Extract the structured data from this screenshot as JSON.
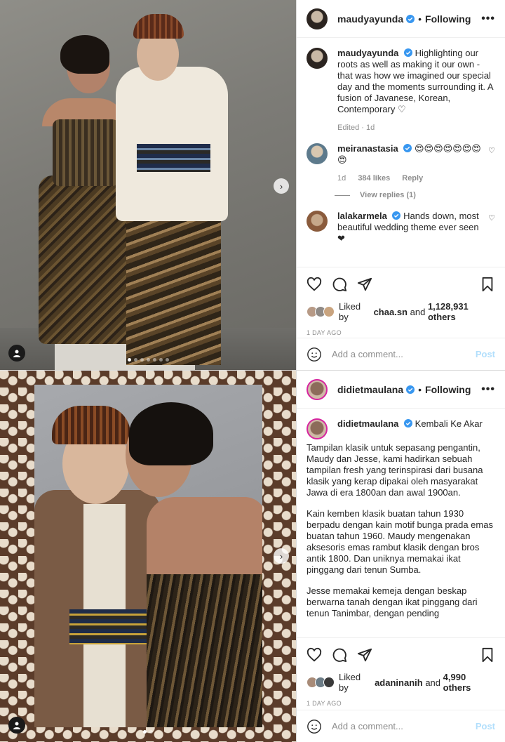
{
  "post1": {
    "header": {
      "username": "maudyayunda",
      "dot": "•",
      "follow_label": "Following",
      "more": "•••"
    },
    "caption": {
      "username": "maudyayunda",
      "text": "Highlighting our roots as well as making it our own - that was how we imagined our special day and the moments surrounding it. A fusion of Javanese, Korean, Contemporary ♡",
      "edited": "Edited · 1d"
    },
    "comments": [
      {
        "username": "meiranastasia",
        "text": "😍😍😍😍😍😍😍😍",
        "age": "1d",
        "likes": "384 likes",
        "reply": "Reply",
        "view_replies": "View replies (1)"
      },
      {
        "username": "lalakarmela",
        "text": "Hands down, most beautiful wedding theme ever seen ❤"
      }
    ],
    "liked_by_prefix": "Liked by",
    "liked_by_user": "chaa.sn",
    "liked_by_and": "and",
    "liked_by_count": "1,128,931 others",
    "time": "1 DAY AGO",
    "add_comment_placeholder": "Add a comment...",
    "post_label": "Post",
    "carousel": {
      "count": 7,
      "active": 0
    }
  },
  "post2": {
    "header": {
      "username": "didietmaulana",
      "dot": "•",
      "follow_label": "Following",
      "more": "•••"
    },
    "caption": {
      "username": "didietmaulana",
      "title": "Kembali Ke Akar",
      "p1": "Tampilan klasik untuk sepasang pengantin, Maudy dan Jesse, kami hadirkan sebuah tampilan fresh yang terinspirasi dari busana klasik yang kerap dipakai oleh masyarakat Jawa di era 1800an dan awal 1900an.",
      "p2": "Kain kemben klasik buatan tahun 1930 berpadu dengan kain motif bunga prada emas buatan tahun 1960. Maudy mengenakan aksesoris emas rambut klasik dengan bros antik 1800. Dan uniknya memakai ikat pinggang dari tenun Sumba.",
      "p3": "Jesse memakai kemeja dengan beskap berwarna tanah dengan ikat pinggang dari tenun Tanimbar, dengan pending"
    },
    "liked_by_prefix": "Liked by",
    "liked_by_user": "adaninanih",
    "liked_by_and": "and",
    "liked_by_count": "4,990 others",
    "time": "1 DAY AGO",
    "add_comment_placeholder": "Add a comment...",
    "post_label": "Post",
    "carousel": {
      "count": 2,
      "active": 0
    }
  },
  "colors": {
    "verified": "#3897f0",
    "post_disabled": "#b2dffc",
    "muted": "#8e8e8e",
    "heart": "#ed4956"
  },
  "icons": [
    "verified-icon",
    "more-icon",
    "heart-icon",
    "comment-icon",
    "share-icon",
    "save-icon",
    "emoji-icon",
    "user-tag-icon",
    "next-arrow-icon"
  ]
}
